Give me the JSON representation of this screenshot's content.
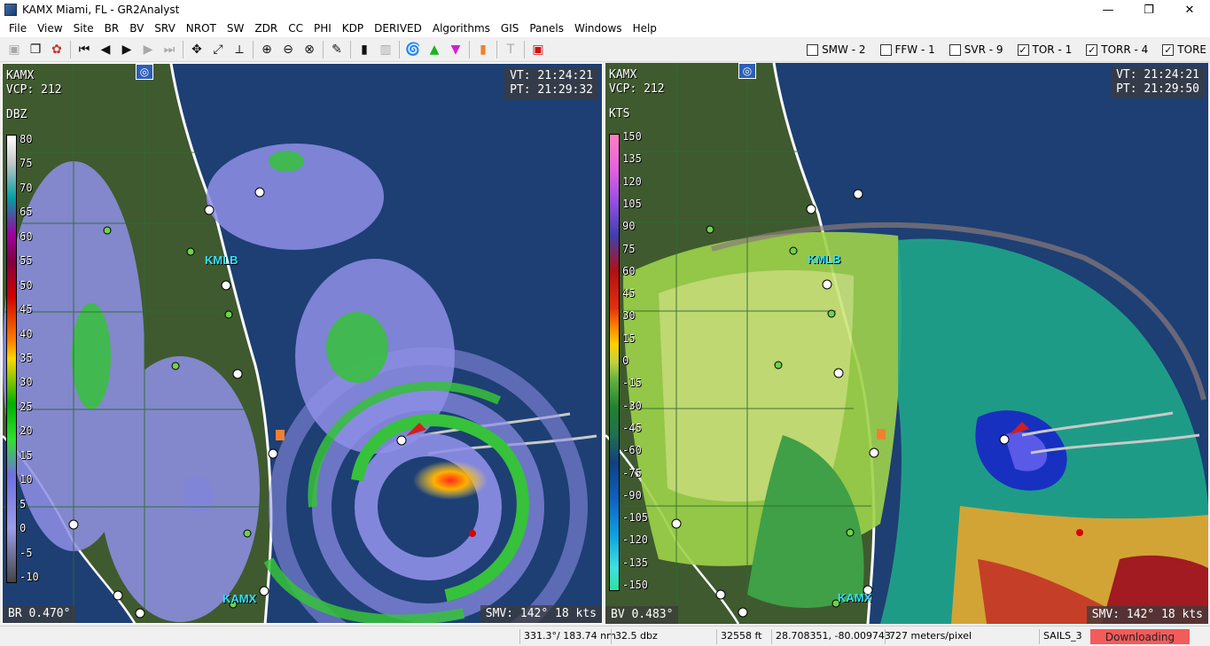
{
  "window": {
    "title": "KAMX Miami, FL - GR2Analyst",
    "minimize": "—",
    "maximize": "❐",
    "close": "✕"
  },
  "menu": [
    "File",
    "View",
    "Site",
    "BR",
    "BV",
    "SRV",
    "NROT",
    "SW",
    "ZDR",
    "CC",
    "PHI",
    "KDP",
    "DERIVED",
    "Algorithms",
    "GIS",
    "Panels",
    "Windows",
    "Help"
  ],
  "warnings": [
    {
      "label": "SMW - 2",
      "checked": false
    },
    {
      "label": "FFW - 1",
      "checked": false
    },
    {
      "label": "SVR - 9",
      "checked": false
    },
    {
      "label": "TOR - 1",
      "checked": true
    },
    {
      "label": "TORR - 4",
      "checked": true
    },
    {
      "label": "TORE",
      "checked": true
    }
  ],
  "left_pane": {
    "site": "KAMX",
    "vcp": "VCP: 212",
    "units": "DBZ",
    "vt": "VT: 21:24:21",
    "pt": "PT: 21:29:32",
    "product": "BR 0.470°",
    "smv": "SMV: 142° 18 kts",
    "scale_labels": [
      "80",
      "75",
      "70",
      "65",
      "60",
      "55",
      "50",
      "45",
      "40",
      "35",
      "30",
      "25",
      "20",
      "15",
      "10",
      "5",
      "0",
      "-5",
      "-10"
    ],
    "city_north": "KMLB",
    "city_south": "KAMX"
  },
  "right_pane": {
    "site": "KAMX",
    "vcp": "VCP: 212",
    "units": "KTS",
    "vt": "VT: 21:24:21",
    "pt": "PT: 21:29:50",
    "product": "BV 0.483°",
    "smv": "SMV: 142° 18 kts",
    "scale_labels": [
      "150",
      "135",
      "120",
      "105",
      "90",
      "75",
      "60",
      "45",
      "30",
      "15",
      "0",
      "-15",
      "-30",
      "-45",
      "-60",
      "-75",
      "-90",
      "-105",
      "-120",
      "-135",
      "-150"
    ],
    "city_north": "KMLB",
    "city_south": "KAMX"
  },
  "status": {
    "azimuth_range": "331.3°/ 183.74 nm",
    "value": "32.5 dbz",
    "height": "32558 ft",
    "latlon": "28.708351, -80.009743",
    "resolution": "727 meters/pixel",
    "mode": "SAILS_3",
    "download": "Downloading"
  },
  "colors": {
    "ocean": "#1d3f73",
    "land": "#3f5a2f",
    "coast": "#ffffff",
    "city_label": "#35e0ff",
    "download_bg": "#f45b5b"
  }
}
